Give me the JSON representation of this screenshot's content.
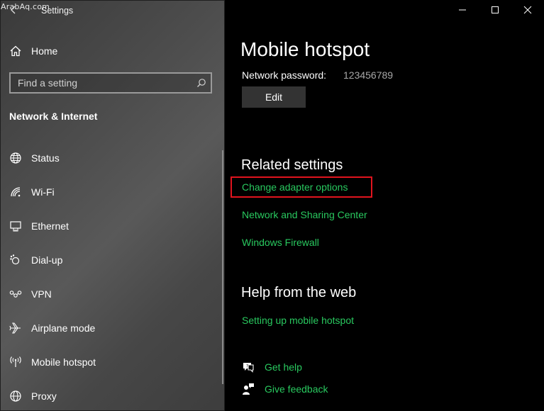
{
  "watermark": "ArabAq.com",
  "app": {
    "title": "Settings"
  },
  "sidebar": {
    "home_label": "Home",
    "search_placeholder": "Find a setting",
    "section_title": "Network & Internet",
    "items": [
      {
        "label": "Status",
        "icon": "globe-icon"
      },
      {
        "label": "Wi-Fi",
        "icon": "wifi-icon"
      },
      {
        "label": "Ethernet",
        "icon": "ethernet-icon"
      },
      {
        "label": "Dial-up",
        "icon": "dialup-icon"
      },
      {
        "label": "VPN",
        "icon": "vpn-icon"
      },
      {
        "label": "Airplane mode",
        "icon": "airplane-icon"
      },
      {
        "label": "Mobile hotspot",
        "icon": "hotspot-icon"
      },
      {
        "label": "Proxy",
        "icon": "globe-icon"
      }
    ]
  },
  "main": {
    "title": "Mobile hotspot",
    "network_password_label": "Network password:",
    "network_password_value": "123456789",
    "edit_label": "Edit",
    "related_title": "Related settings",
    "related_links": [
      "Change adapter options",
      "Network and Sharing Center",
      "Windows Firewall"
    ],
    "help_title": "Help from the web",
    "help_link": "Setting up mobile hotspot",
    "get_help": "Get help",
    "give_feedback": "Give feedback"
  },
  "colors": {
    "link": "#29c95f",
    "highlight": "#e0141e",
    "edit_button": "#333333"
  }
}
